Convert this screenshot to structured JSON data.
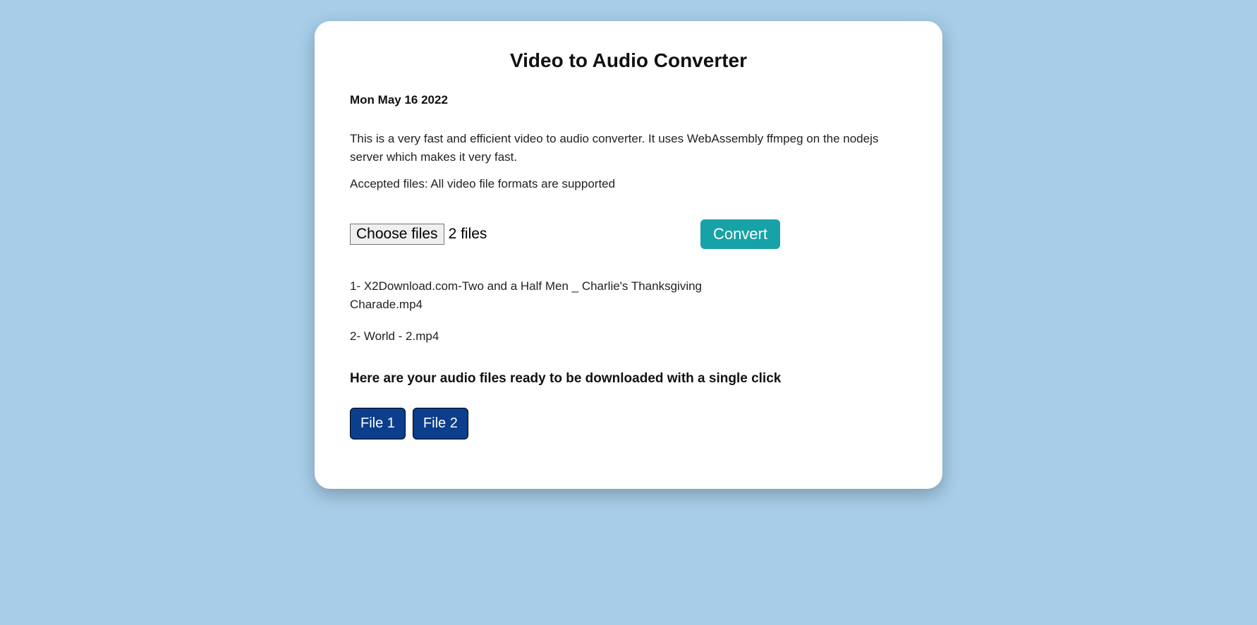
{
  "title": "Video to Audio Converter",
  "date": "Mon May 16 2022",
  "description": "This is a very fast and efficient video to audio converter. It uses WebAssembly ffmpeg on the nodejs server which makes it very fast.",
  "accepted": "Accepted files: All video file formats are supported",
  "choose_label": "Choose files",
  "file_count": "2 files",
  "convert_label": "Convert",
  "files": [
    "1- X2Download.com-Two and a Half Men _ Charlie's Thanksgiving Charade.mp4",
    "2- World - 2.mp4"
  ],
  "ready_heading": "Here are your audio files ready to be downloaded with a single click",
  "downloads": [
    "File 1",
    "File 2"
  ]
}
